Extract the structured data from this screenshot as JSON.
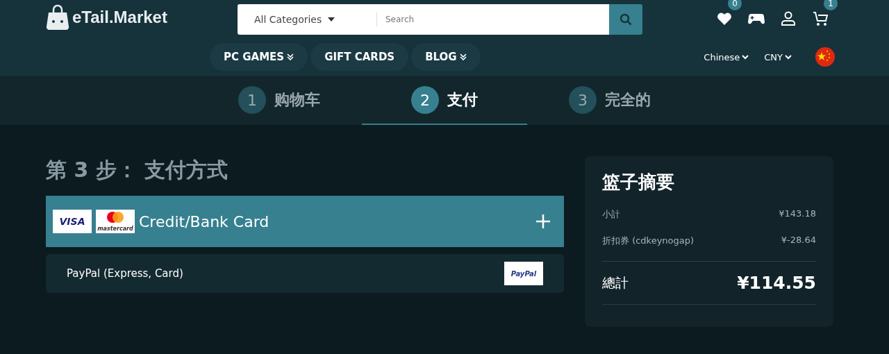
{
  "header": {
    "logo": "eTail.Market",
    "search": {
      "category": "All Categories",
      "placeholder": "Search"
    },
    "badges": {
      "wishlist": "0",
      "cart": "1"
    },
    "nav": [
      {
        "label": "PC GAMES",
        "dropdown": true
      },
      {
        "label": "GIFT CARDS",
        "dropdown": false
      },
      {
        "label": "BLOG",
        "dropdown": true
      }
    ],
    "language": "Chinese",
    "currency": "CNY"
  },
  "steps": [
    {
      "number": "1",
      "label": "购物车",
      "selected": false
    },
    {
      "number": "2",
      "label": "支付",
      "selected": true
    },
    {
      "number": "3",
      "label": "完全的",
      "selected": false
    }
  ],
  "payment": {
    "title": "第 3 步： 支付方式",
    "methods": [
      {
        "kind": "card",
        "label": "Credit/Bank Card",
        "selected": true,
        "logos": [
          "VISA",
          "mastercard"
        ]
      },
      {
        "kind": "paypal",
        "label": "PayPal (Express, Card)",
        "selected": false,
        "logos": [
          "PayPal"
        ]
      }
    ]
  },
  "summary": {
    "title": "篮子摘要",
    "lines": [
      {
        "label": "小計",
        "value": "¥143.18"
      },
      {
        "label": "折扣券 (cdkeynogap)",
        "value": "¥-28.64"
      }
    ],
    "total": {
      "label": "總計",
      "value": "¥114.55"
    }
  }
}
